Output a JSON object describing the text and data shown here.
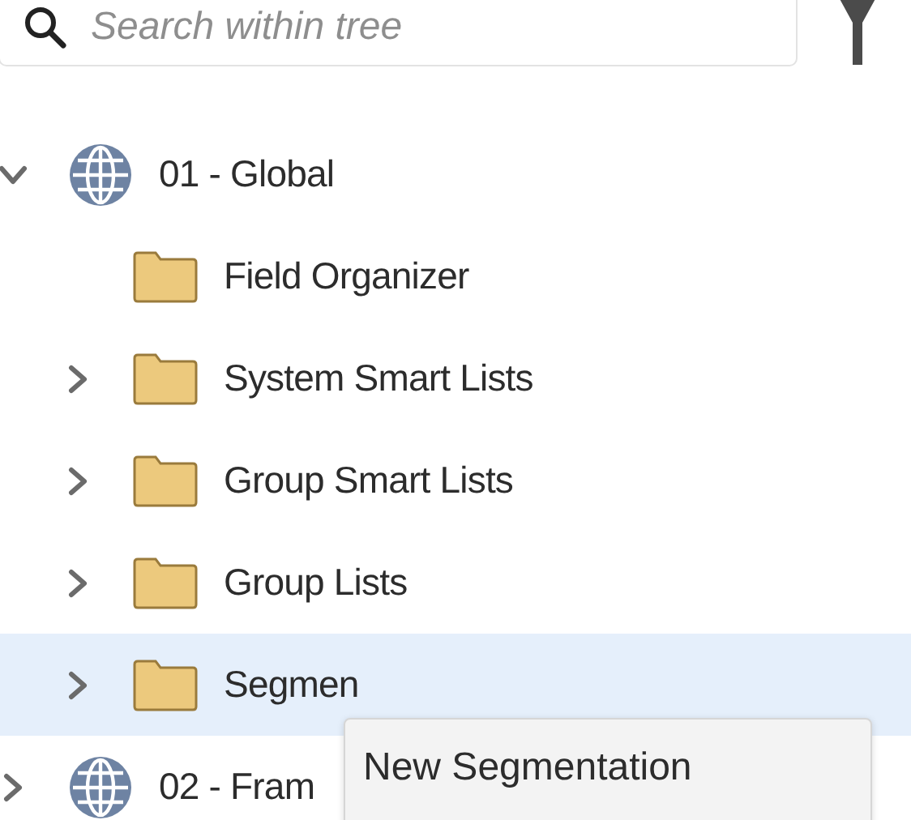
{
  "search": {
    "placeholder": "Search within tree"
  },
  "tree": [
    {
      "label": "01 - Global",
      "kind": "globe",
      "expandable": true,
      "expanded": true,
      "selected": false,
      "children": [
        {
          "label": "Field Organizer",
          "kind": "folder",
          "expandable": false,
          "expanded": false,
          "selected": false
        },
        {
          "label": "System Smart Lists",
          "kind": "folder",
          "expandable": true,
          "expanded": false,
          "selected": false
        },
        {
          "label": "Group Smart Lists",
          "kind": "folder",
          "expandable": true,
          "expanded": false,
          "selected": false
        },
        {
          "label": "Group Lists",
          "kind": "folder",
          "expandable": true,
          "expanded": false,
          "selected": false
        },
        {
          "label": "Segmen",
          "kind": "folder",
          "expandable": true,
          "expanded": false,
          "selected": true
        }
      ]
    },
    {
      "label": "02 - Fram",
      "kind": "globe",
      "expandable": true,
      "expanded": false,
      "selected": false
    }
  ],
  "context_menu": {
    "items": [
      "New Segmentation"
    ]
  }
}
